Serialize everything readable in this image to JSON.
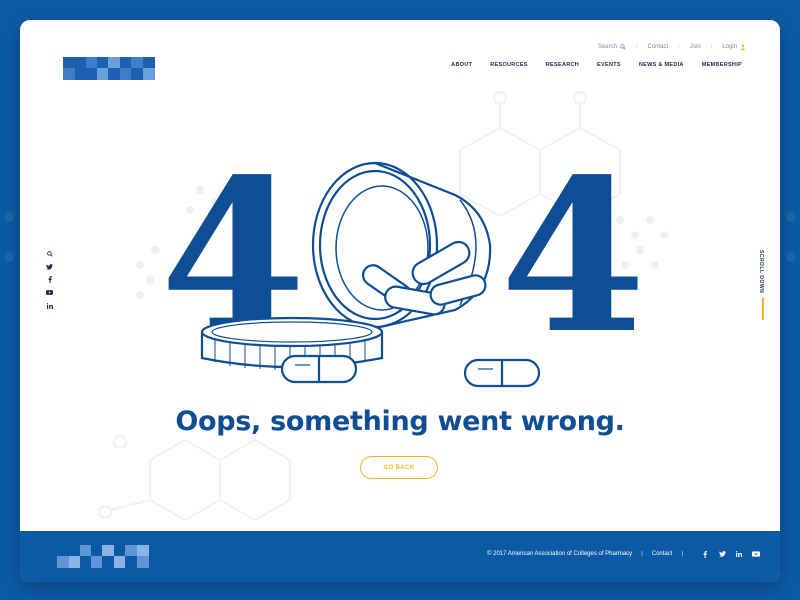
{
  "header": {
    "utility": {
      "search_label": "Search",
      "contact_label": "Contact",
      "join_label": "Join",
      "login_label": "Login"
    },
    "nav": [
      "ABOUT",
      "RESOURCES",
      "RESEARCH",
      "EVENTS",
      "NEWS & MEDIA",
      "MEMBERSHIP"
    ]
  },
  "social_left": [
    "search-icon",
    "twitter-icon",
    "facebook-icon",
    "youtube-icon",
    "linkedin-icon"
  ],
  "scroll_label": "SCROLL DOWN",
  "hero": {
    "digit_left": "4",
    "digit_right": "4"
  },
  "message": "Oops, something went wrong.",
  "go_back_label": "GO BACK",
  "footer": {
    "copyright": "© 2017 American Association of Colleges of Pharmacy",
    "contact_label": "Contact",
    "social": [
      "facebook-icon",
      "twitter-icon",
      "linkedin-icon",
      "youtube-icon"
    ]
  },
  "colors": {
    "brand_blue": "#0c5aa6",
    "dark_blue": "#0f4d95",
    "accent_yellow": "#f2b51d",
    "nav_text": "#1b2b4a"
  }
}
